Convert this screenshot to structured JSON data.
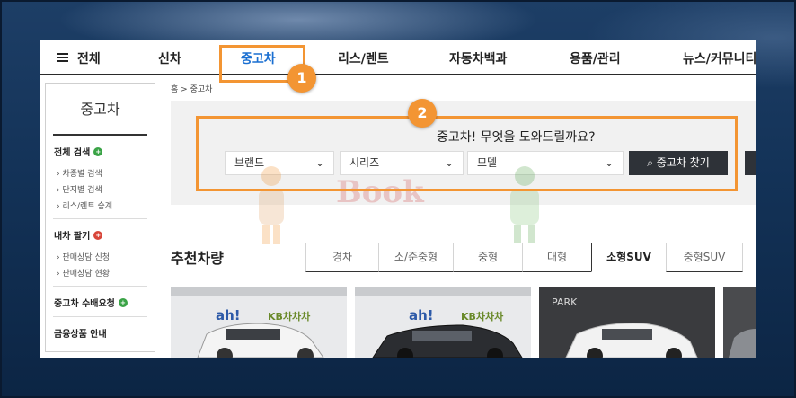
{
  "nav": {
    "all": "전체",
    "items": [
      "신차",
      "중고차",
      "리스/렌트",
      "자동차백과",
      "용품/관리",
      "뉴스/커뮤니티"
    ]
  },
  "sidebar": {
    "title": "중고차",
    "sections": [
      {
        "label": "전체 검색",
        "links": [
          "차종별 검색",
          "단지별 검색",
          "리스/렌트 승계"
        ]
      },
      {
        "label": "내차 팔기",
        "links": [
          "판매상담 신청",
          "판매상담 현황"
        ]
      },
      {
        "label": "중고차 수배요청",
        "links": []
      },
      {
        "label": "금융상품 안내",
        "links": []
      }
    ]
  },
  "breadcrumb": {
    "home": "홈",
    "separator": ">",
    "current": "중고차"
  },
  "search": {
    "question": "중고차! 무엇을 도와드릴까요?",
    "brand": "브랜드",
    "series": "시리즈",
    "model": "모델",
    "button": "중고차 찾기"
  },
  "watermark": "Book",
  "annotations": {
    "badge1": "1",
    "badge2": "2"
  },
  "recommended": {
    "title": "추천차량",
    "tabs": [
      "경차",
      "소/준중형",
      "중형",
      "대형",
      "소형SUV",
      "중형SUV"
    ],
    "active_tab": "소형SUV"
  },
  "cars": [
    {
      "sign": "ah!",
      "brand": "KB차차차"
    },
    {
      "sign": "ah!",
      "brand": "KB차차차"
    },
    {
      "sign": "PARK",
      "brand": ""
    },
    {
      "sign": "",
      "brand": ""
    }
  ],
  "colors": {
    "accent": "#1a6fd1",
    "annotation": "#f39533",
    "button": "#2e3238"
  }
}
